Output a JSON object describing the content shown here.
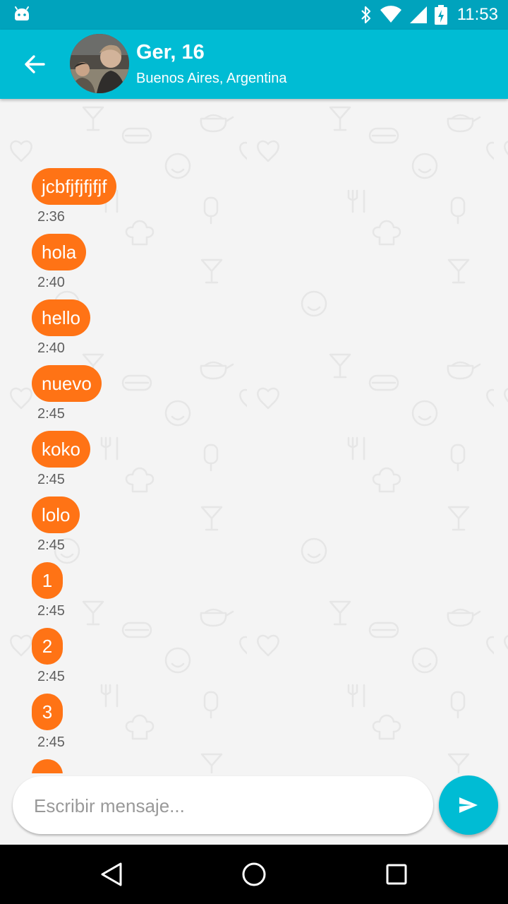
{
  "status_bar": {
    "time": "11:53",
    "icons": [
      "android-icon",
      "bluetooth-icon",
      "wifi-icon",
      "signal-icon",
      "battery-charging-icon"
    ]
  },
  "header": {
    "name": "Ger, 16",
    "location": "Buenos Aires, Argentina",
    "back_icon": "arrow-left-icon"
  },
  "messages": [
    {
      "text": "jcbfjfjfjfjf",
      "time": "2:36"
    },
    {
      "text": "hola",
      "time": "2:40"
    },
    {
      "text": "hello",
      "time": "2:40"
    },
    {
      "text": "nuevo",
      "time": "2:45"
    },
    {
      "text": "koko",
      "time": "2:45"
    },
    {
      "text": "lolo",
      "time": "2:45"
    },
    {
      "text": "1",
      "time": "2:45"
    },
    {
      "text": "2",
      "time": "2:45"
    },
    {
      "text": "3",
      "time": "2:45"
    }
  ],
  "input": {
    "placeholder": "Escribir mensaje...",
    "value": ""
  },
  "send_icon": "send-icon",
  "nav": {
    "icons": [
      "back-triangle-icon",
      "home-circle-icon",
      "recents-square-icon"
    ]
  },
  "colors": {
    "status_bar": "#00a3bd",
    "app_bar": "#00bcd4",
    "bubble": "#ff7315",
    "background": "#f4f4f4",
    "nav_bar": "#000000"
  }
}
